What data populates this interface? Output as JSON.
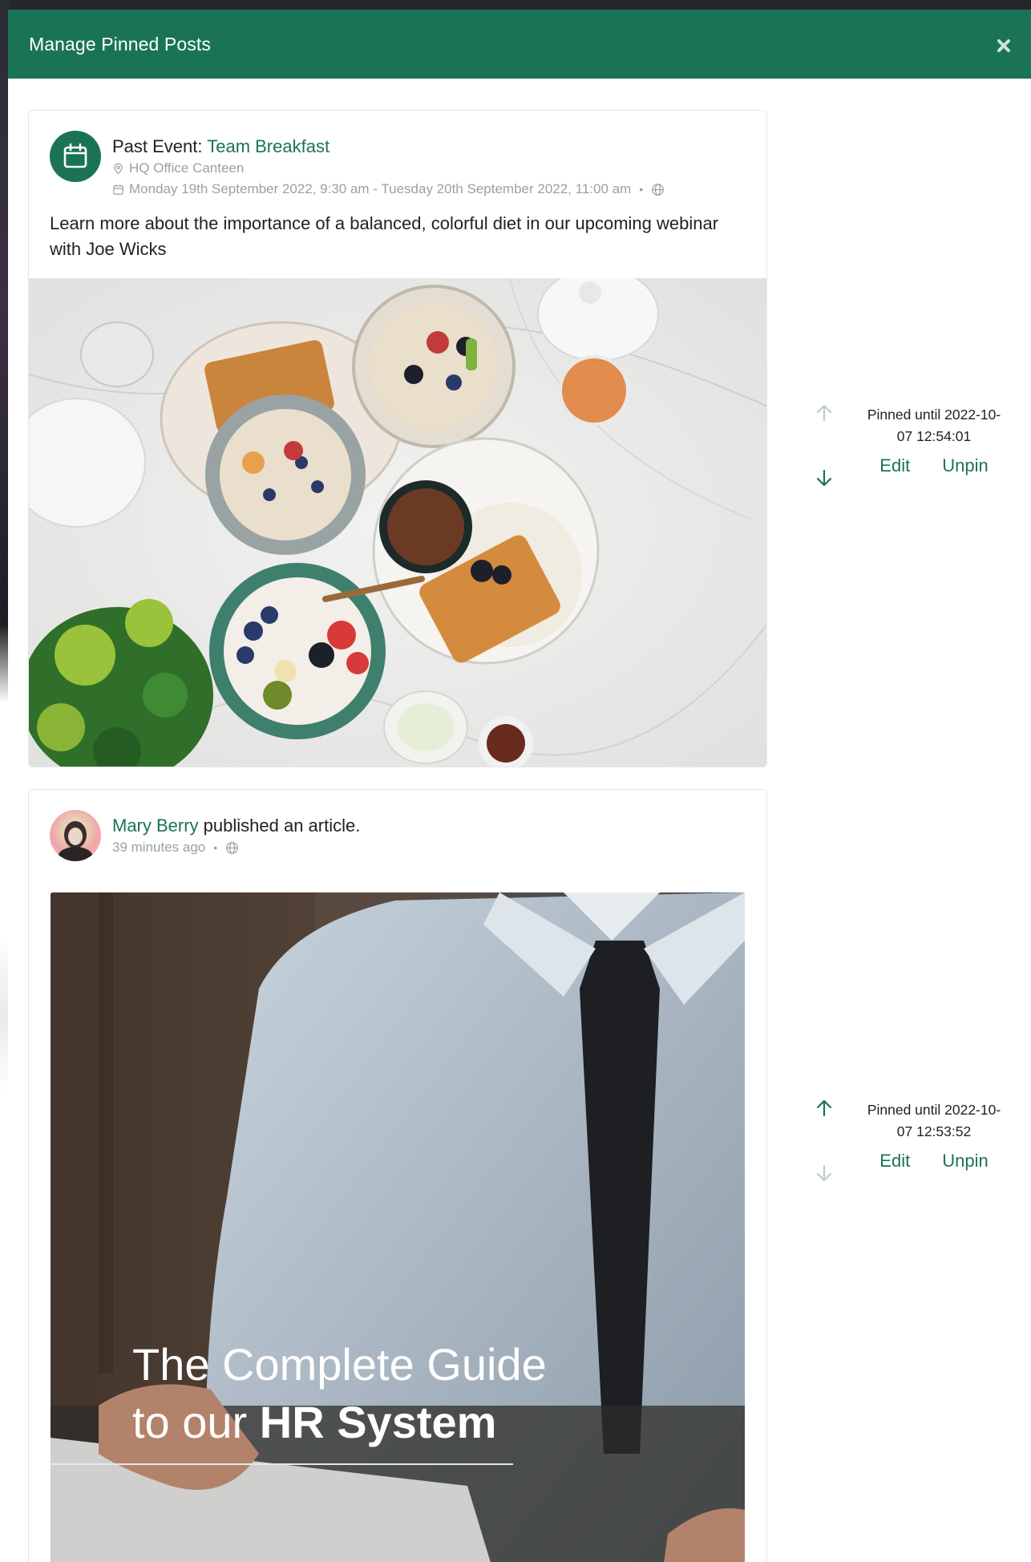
{
  "modal": {
    "title": "Manage Pinned Posts"
  },
  "posts": [
    {
      "prefix": "Past Event: ",
      "title_link": "Team Breakfast",
      "location": "HQ Office Canteen",
      "dates": "Monday 19th September 2022, 9:30 am - Tuesday 20th September 2022, 11:00 am",
      "body": "Learn more about the importance of a balanced, colorful diet in our upcoming webinar with Joe Wicks",
      "pinned_until": "Pinned until 2022-10-07 12:54:01",
      "edit_label": "Edit",
      "unpin_label": "Unpin"
    },
    {
      "author": "Mary Berry",
      "action": " published an article.",
      "time": "39 minutes ago",
      "article_title_light_1": "The Complete Guide",
      "article_title_light_2": "to our ",
      "article_title_bold": "HR System",
      "pinned_until": "Pinned until 2022-10-07 12:53:52",
      "edit_label": "Edit",
      "unpin_label": "Unpin"
    }
  ],
  "colors": {
    "brand": "#1b7355",
    "muted": "#9aa0a6"
  }
}
